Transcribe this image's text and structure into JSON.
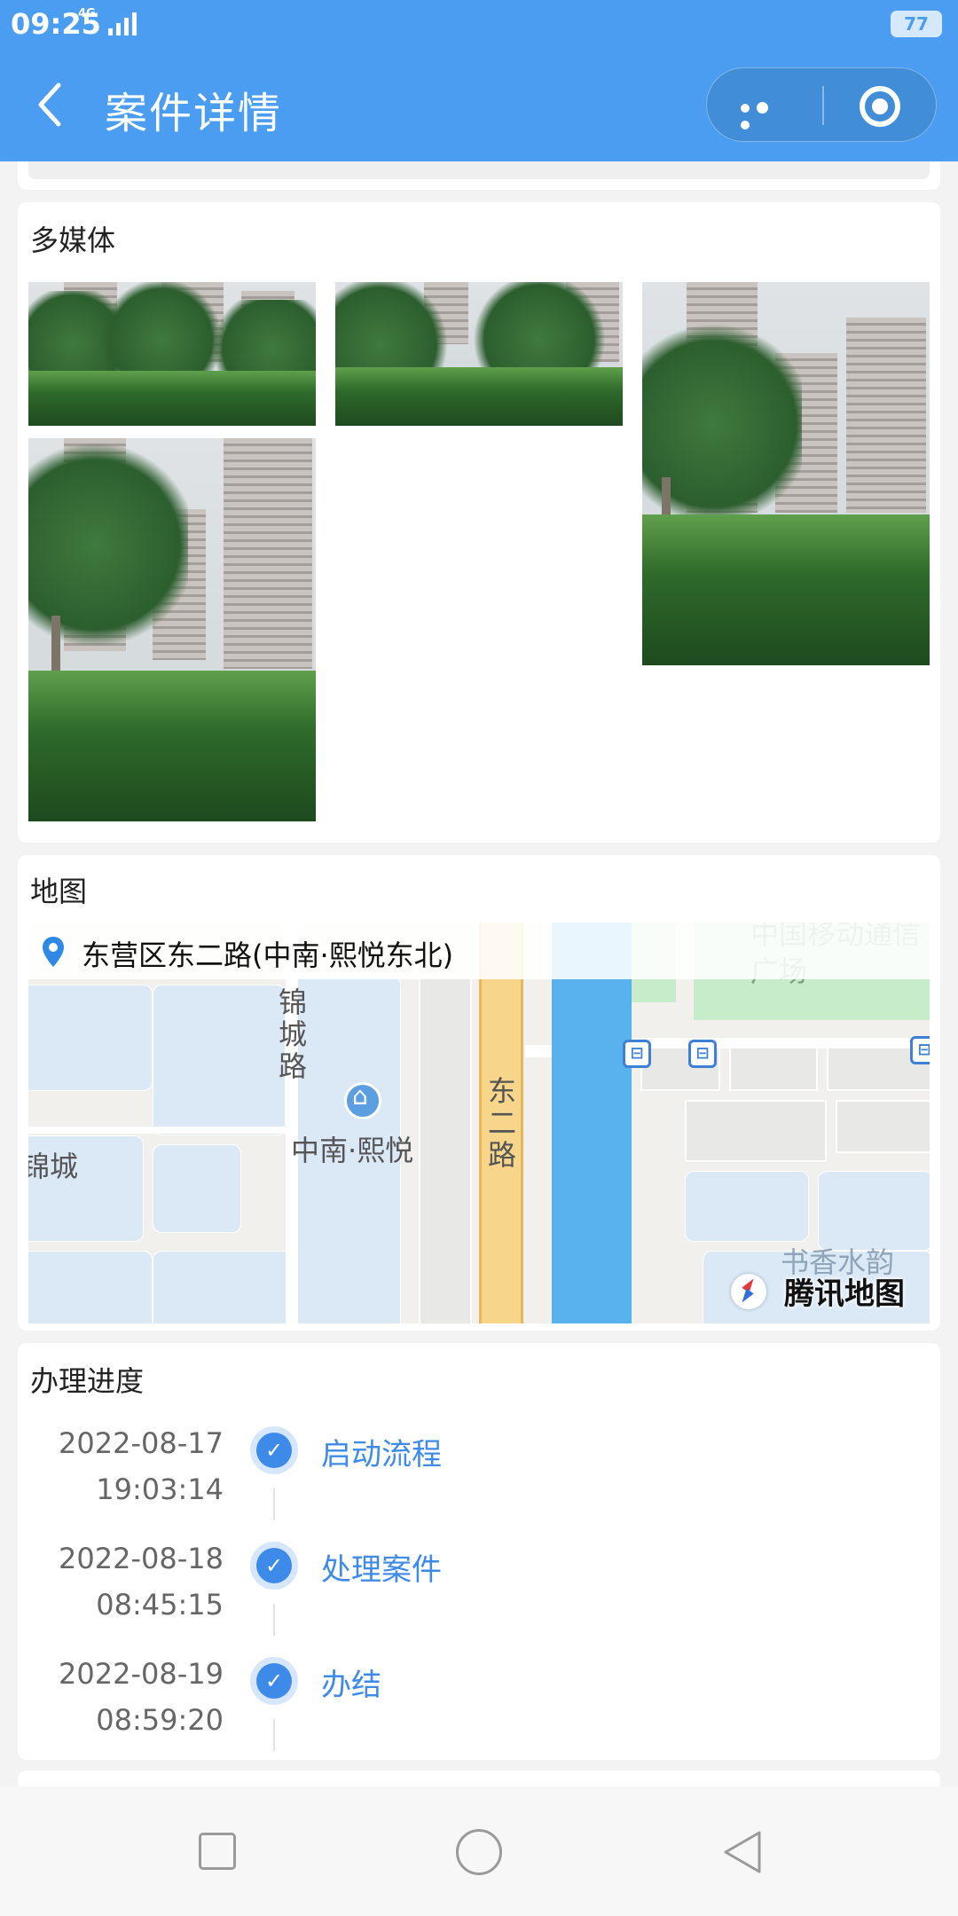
{
  "status_bar": {
    "time": "09:25",
    "network": "4G",
    "battery": "77"
  },
  "header": {
    "title": "案件详情",
    "back_icon": "chevron-left-icon",
    "more_icon": "more-dots-icon",
    "close_icon": "target-icon"
  },
  "media": {
    "title": "多媒体",
    "photos": [
      "photo-1",
      "photo-2",
      "photo-3",
      "photo-4"
    ]
  },
  "map": {
    "title": "地图",
    "location": "东营区东二路(中南·熙悦东北)",
    "labels": {
      "road1": "锦城路",
      "poi": "中南·熙悦",
      "road2": "东二路",
      "area": "锦城",
      "plaza": "中国移动通信广场",
      "residence": "书香水韵"
    },
    "watermark": "腾讯地图"
  },
  "progress": {
    "title": "办理进度",
    "steps": [
      {
        "date": "2022-08-17",
        "time": "19:03:14",
        "label": "启动流程"
      },
      {
        "date": "2022-08-18",
        "time": "08:45:15",
        "label": "处理案件"
      },
      {
        "date": "2022-08-19",
        "time": "08:59:20",
        "label": "办结"
      }
    ]
  },
  "colors": {
    "header_bg": "#4a9df0",
    "accent": "#3d8ae8",
    "card_bg": "#ffffff"
  }
}
